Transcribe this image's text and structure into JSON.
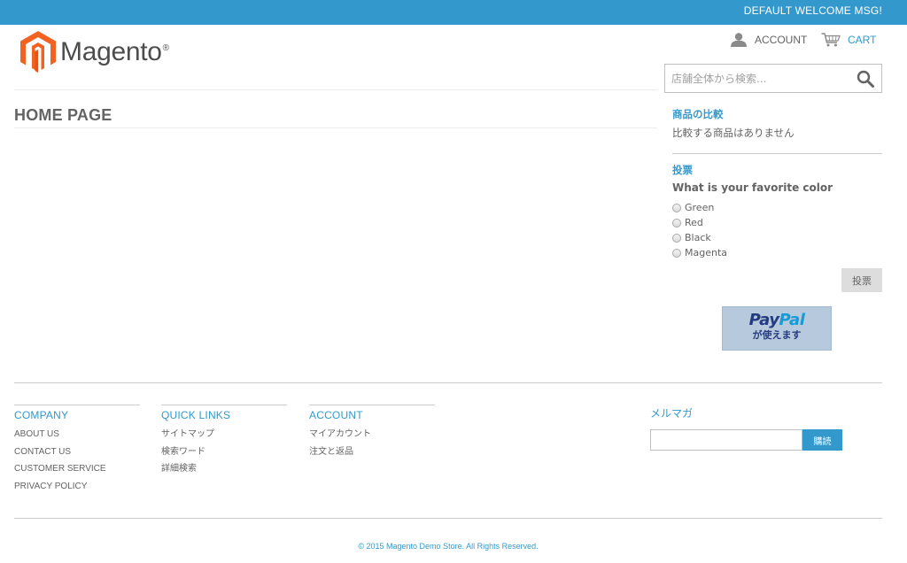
{
  "header": {
    "welcome_message": "DEFAULT WELCOME MSG!",
    "logo_text": "Magento",
    "logo_reg": "®",
    "account_label": "ACCOUNT",
    "cart_label": "CART",
    "search_placeholder": "店舗全体から検索..."
  },
  "main": {
    "page_title": "HOME PAGE"
  },
  "sidebar": {
    "compare": {
      "title": "商品の比較",
      "empty_text": "比較する商品はありません"
    },
    "poll": {
      "title": "投票",
      "question": "What is your favorite color",
      "options": [
        "Green",
        "Red",
        "Black",
        "Magenta"
      ],
      "vote_label": "投票"
    },
    "paypal": {
      "line1_a": "Pay",
      "line1_b": "Pal",
      "line2": "が使えます"
    }
  },
  "footer": {
    "columns": [
      {
        "title": "COMPANY",
        "links": [
          "ABOUT US",
          "CONTACT US",
          "CUSTOMER SERVICE",
          "PRIVACY POLICY"
        ]
      },
      {
        "title": "QUICK LINKS",
        "links": [
          "サイトマップ",
          "検索ワード",
          "詳細検索"
        ]
      },
      {
        "title": "ACCOUNT",
        "links": [
          "マイアカウント",
          "注文と返品"
        ]
      }
    ],
    "newsletter": {
      "title": "メルマガ",
      "button_label": "購読"
    },
    "copyright": "© 2015 Magento Demo Store. All Rights Reserved."
  },
  "colors": {
    "brand_blue": "#3399cc",
    "logo_orange": "#f26322",
    "text_gray": "#636363"
  },
  "icons": {
    "account": "user-icon",
    "cart": "cart-icon",
    "search": "search-icon",
    "logo": "magento-logo-icon"
  }
}
